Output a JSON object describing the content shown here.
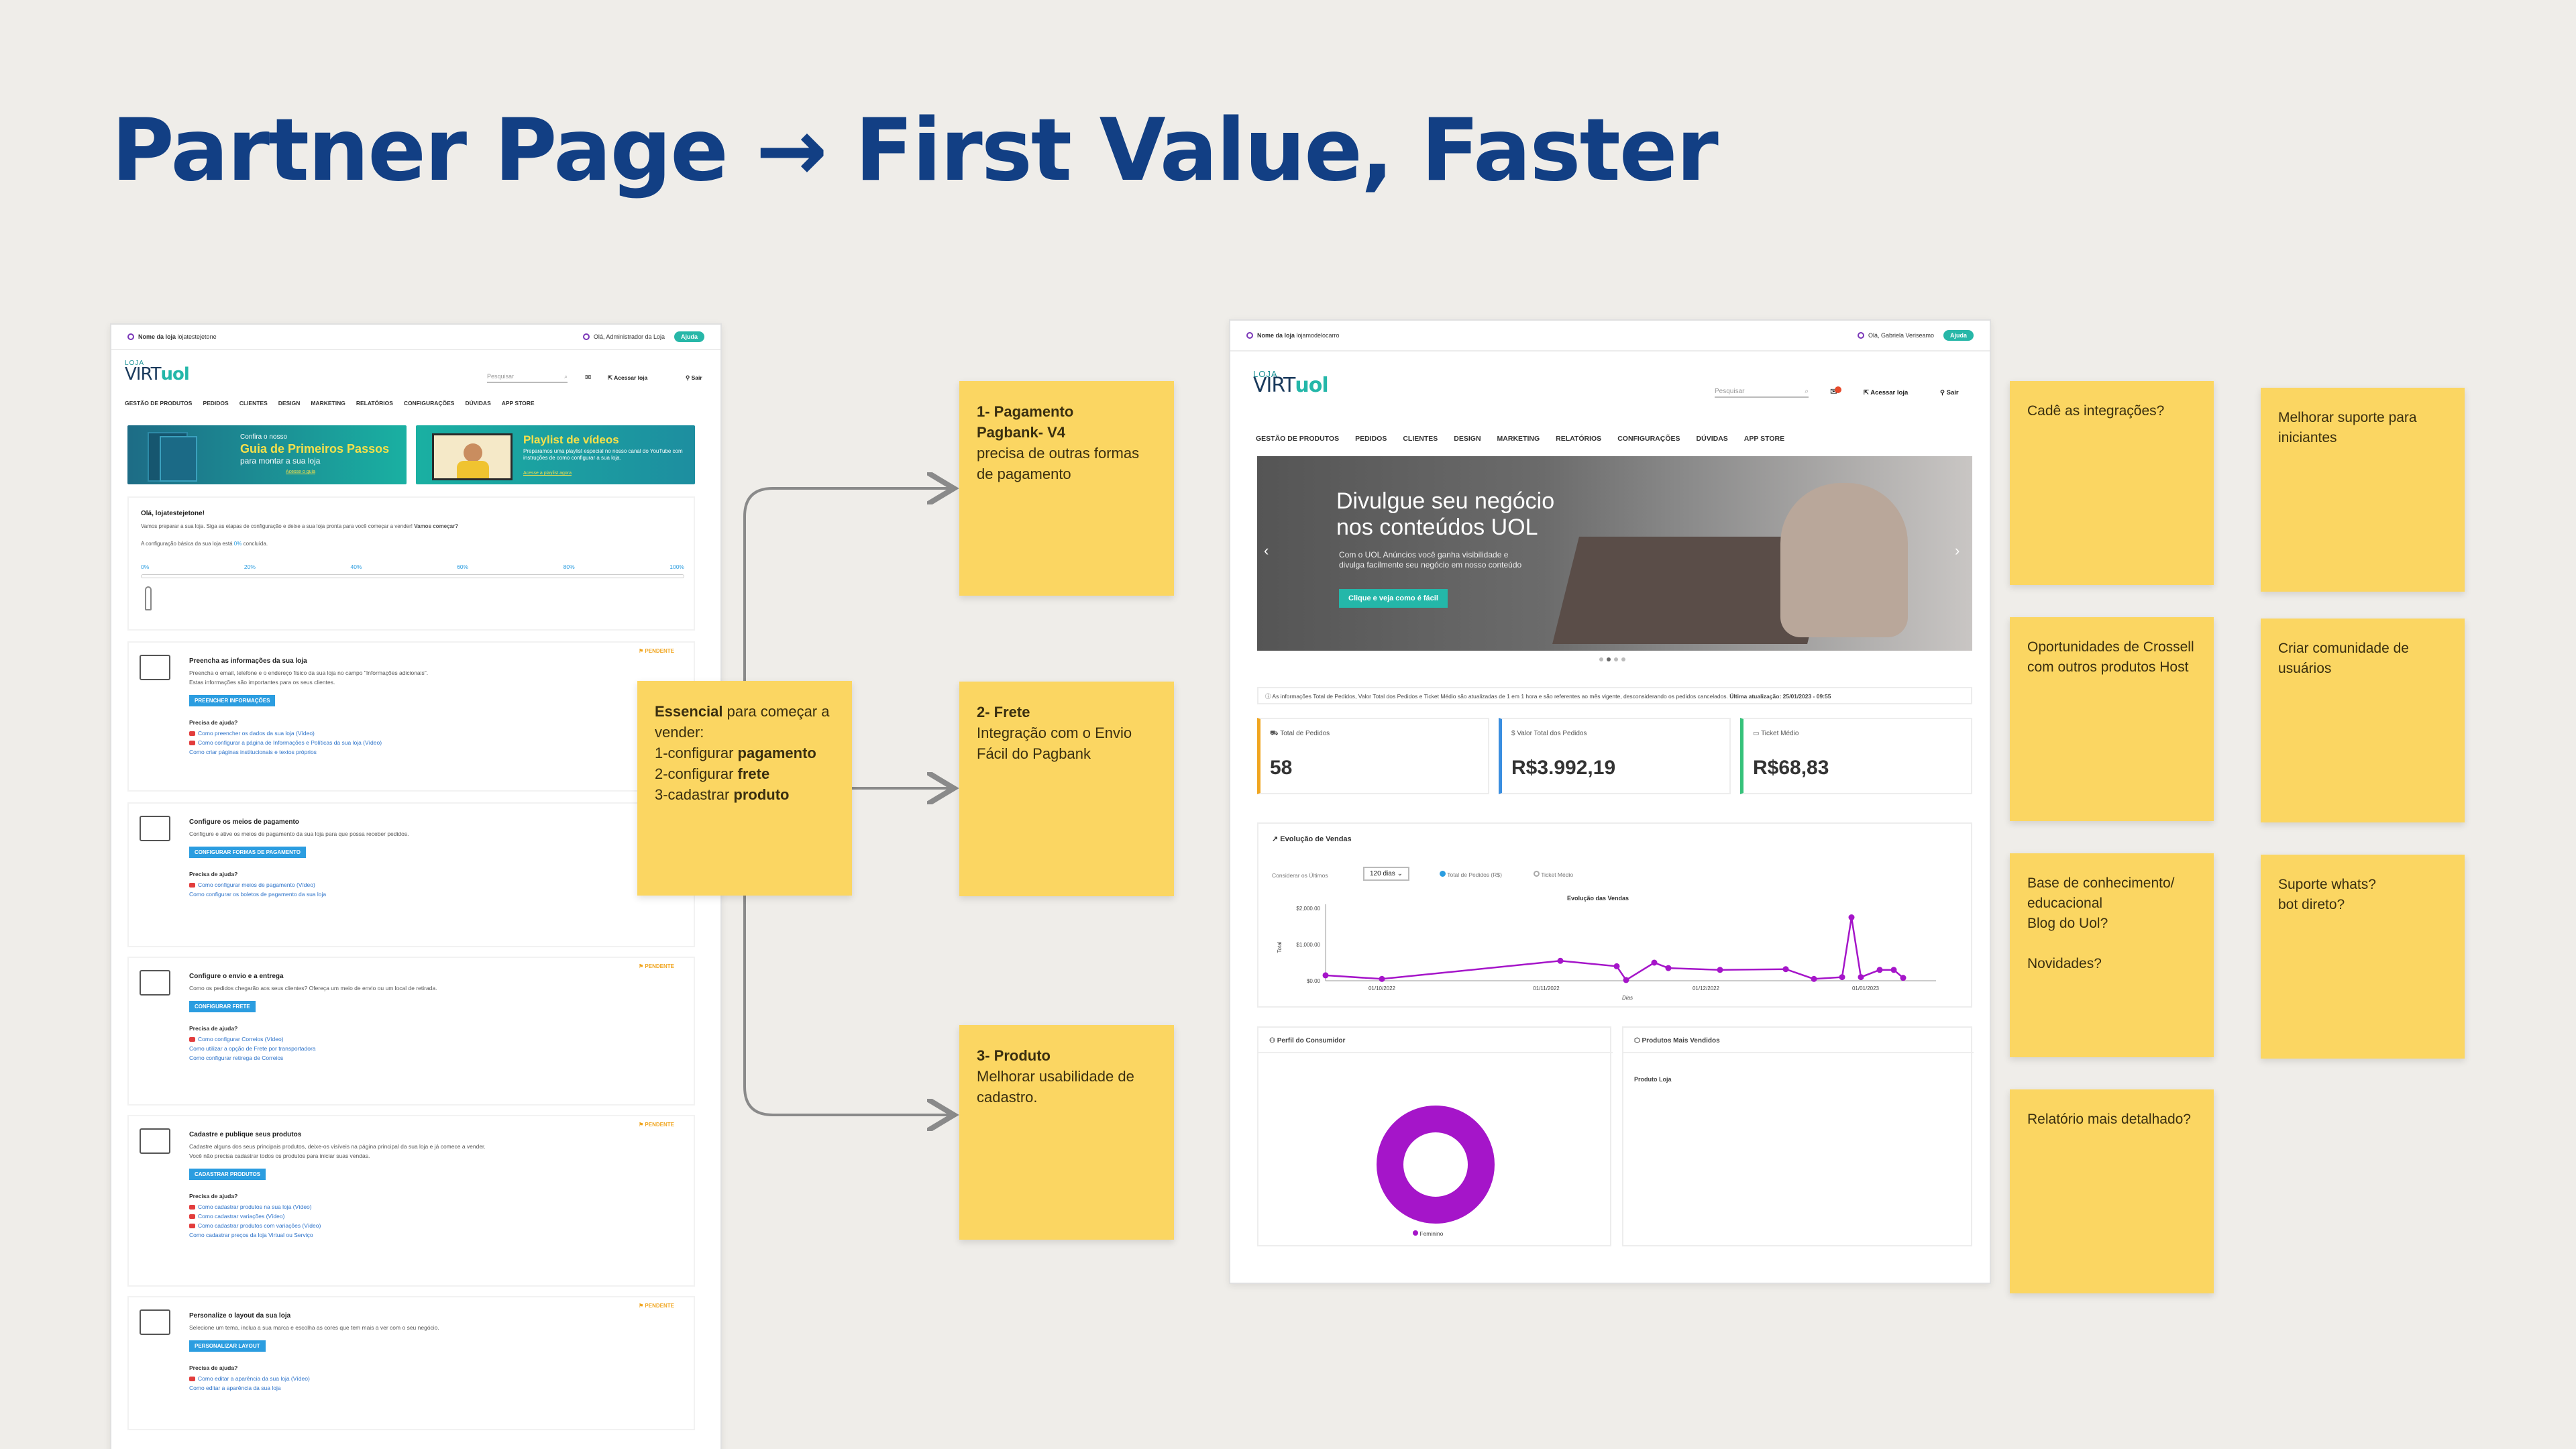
{
  "title": "Partner Page → First Value, Faster",
  "left_screen": {
    "store_label": "Nome da loja",
    "store_name": "lojatestejetone",
    "greeting": "Olá, Administrador da Loja",
    "help": "Ajuda",
    "logo_loja": "LOJA",
    "logo_virt": "VIRT",
    "logo_uol": "uol",
    "search_placeholder": "Pesquisar",
    "access_store": "Acessar loja",
    "logout": "Sair",
    "menu": [
      "GESTÃO DE PRODUTOS",
      "PEDIDOS",
      "CLIENTES",
      "DESIGN",
      "MARKETING",
      "RELATÓRIOS",
      "CONFIGURAÇÕES",
      "DÚVIDAS",
      "APP STORE"
    ],
    "banner1": {
      "pre": "Confira o nosso",
      "title": "Guia de Primeiros Passos",
      "sub": "para montar a sua loja",
      "cta": "Acesse o guia"
    },
    "banner2": {
      "title": "Playlist de vídeos",
      "text": "Preparamos uma playlist especial no nosso canal do YouTube com instruções de como configurar a sua loja.",
      "cta": "Acesse a playlist agora"
    },
    "welcome": {
      "title": "Olá, lojatestejetone!",
      "text": "Vamos preparar a sua loja. Siga as etapas de configuração e deixe a sua loja pronta para você começar a vender!",
      "cta": "Vamos começar?",
      "progress_text": "A configuração básica da sua loja está",
      "progress_value": "0%",
      "progress_suffix": "concluída.",
      "ticks": [
        "0%",
        "20%",
        "40%",
        "60%",
        "80%",
        "100%"
      ]
    },
    "pending_label": "PENDENTE",
    "help_label": "Precisa de ajuda?",
    "cards": [
      {
        "title": "Preencha as informações da sua loja",
        "desc": "Preencha o email, telefone e o endereço físico da sua loja no campo \"Informações adicionais\".",
        "desc2": "Estas informações são importantes para os seus clientes.",
        "button": "PREENCHER INFORMAÇÕES",
        "links": [
          "Como preencher os dados da sua loja (Vídeo)",
          "Como configurar a página de Informações e Políticas da sua loja (Vídeo)",
          "Como criar páginas institucionais e textos próprios"
        ]
      },
      {
        "title": "Configure os meios de pagamento",
        "desc": "Configure e ative os meios de pagamento da sua loja para que possa receber pedidos.",
        "desc2": "",
        "button": "CONFIGURAR FORMAS DE PAGAMENTO",
        "links": [
          "Como configurar meios de pagamento (Vídeo)",
          "Como configurar os boletos de pagamento da sua loja"
        ]
      },
      {
        "title": "Configure o envio e a entrega",
        "desc": "Como os pedidos chegarão aos seus clientes? Ofereça um meio de envio ou um local de retirada.",
        "desc2": "",
        "button": "CONFIGURAR FRETE",
        "links": [
          "Como configurar Correios (Vídeo)",
          "Como utilizar a opção de Frete por transportadora",
          "Como configurar retirega de Correios"
        ]
      },
      {
        "title": "Cadastre e publique seus produtos",
        "desc": "Cadastre alguns dos seus principais produtos, deixe-os visíveis na página principal da sua loja e já comece a vender.",
        "desc2": "Você não precisa cadastrar todos os produtos para iniciar suas vendas.",
        "button": "CADASTRAR PRODUTOS",
        "links": [
          "Como cadastrar produtos na sua loja (Vídeo)",
          "Como cadastrar variações (Vídeo)",
          "Como cadastrar produtos com variações (Vídeo)",
          "Como cadastrar preços da loja Virtual ou Serviço"
        ]
      },
      {
        "title": "Personalize o layout da sua loja",
        "desc": "Selecione um tema, inclua a sua marca e escolha as cores que tem mais a ver com o seu negócio.",
        "desc2": "",
        "button": "PERSONALIZAR LAYOUT",
        "links": [
          "Como editar a aparência da sua loja (Vídeo)",
          "Como editar a aparência da sua loja"
        ]
      }
    ]
  },
  "notes": {
    "center": {
      "bold": "Essencial",
      "rest": " para começar a vender:",
      "line1_pre": "1-configurar ",
      "line1_bold": "pagamento",
      "line2_pre": "2-configurar ",
      "line2_bold": "frete",
      "line3_pre": "3-cadastrar ",
      "line3_bold": "produto"
    },
    "payment": {
      "title": "1- Pagamento",
      "title2": "Pagbank- V4",
      "text": "precisa de outras formas de pagamento"
    },
    "shipping": {
      "title": "2- Frete",
      "text": "Integração com o Envio Fácil do Pagbank"
    },
    "product": {
      "title": "3- Produto",
      "text": "Melhorar usabilidade de cadastro."
    },
    "right": [
      "Cadê as integrações?",
      "Melhorar suporte para iniciantes",
      "Oportunidades de Crossell com outros produtos Host",
      "Criar comunidade de usuários",
      "Base de conhecimento/ educacional\nBlog do Uol?\n\nNovidades?",
      "Suporte whats?\nbot direto?",
      "Relatório mais detalhado?"
    ]
  },
  "right_screen": {
    "store_label": "Nome da loja",
    "store_name": "lojamodelocarro",
    "greeting": "Olá, Gabriela Veriseamo",
    "help": "Ajuda",
    "search_placeholder": "Pesquisar",
    "access_store": "Acessar loja",
    "logout": "Sair",
    "menu": [
      "GESTÃO DE PRODUTOS",
      "PEDIDOS",
      "CLIENTES",
      "DESIGN",
      "MARKETING",
      "RELATÓRIOS",
      "CONFIGURAÇÕES",
      "DÚVIDAS",
      "APP STORE"
    ],
    "hero": {
      "title1": "Divulgue seu negócio",
      "title2": "nos conteúdos UOL",
      "text1": "Com o UOL Anúncios você ganha visibilidade e",
      "text2": "divulga facilmente seu negócio em nosso conteúdo",
      "cta": "Clique e veja como é fácil"
    },
    "info_text": "As informações Total de Pedidos, Valor Total dos Pedidos e Ticket Médio são atualizadas de 1 em 1 hora e são referentes ao mês vigente, desconsiderando os pedidos cancelados.",
    "info_update_label": "Última atualização:",
    "info_update_value": "25/01/2023 - 09:55",
    "kpis": [
      {
        "label": "Total de Pedidos",
        "value": "58",
        "color": "#f0a51f"
      },
      {
        "label": "Valor Total dos Pedidos",
        "value": "R$3.992,19",
        "color": "#3a8ee0"
      },
      {
        "label": "Ticket Médio",
        "value": "R$68,83",
        "color": "#36c27a"
      }
    ],
    "sales_title": "Evolução de Vendas",
    "filter_label": "Considerar os Últimos",
    "filter_value": "120 dias",
    "radio1": "Total de Pedidos (R$)",
    "radio2": "Ticket Médio",
    "consumer_title": "Perfil do Consumidor",
    "consumer_legend": "Feminino",
    "top_products_title": "Produtos Mais Vendidos",
    "top_products_col": "Produto Loja"
  },
  "chart_data": {
    "type": "line",
    "title": "Evolução das Vendas",
    "xlabel": "Dias",
    "ylabel": "Total",
    "x_ticks": [
      "01/10/2022",
      "01/11/2022",
      "01/12/2022",
      "01/01/2023"
    ],
    "y_ticks": [
      "$0.00",
      "$1,000.00",
      "$2,000.00"
    ],
    "ylim": [
      0,
      2000
    ],
    "x": [
      0,
      12,
      50,
      62,
      64,
      70,
      73,
      84,
      98,
      104,
      110,
      112,
      114,
      118,
      121,
      123
    ],
    "values": [
      150,
      50,
      550,
      400,
      20,
      500,
      350,
      300,
      320,
      50,
      100,
      1750,
      100,
      300,
      300,
      80
    ],
    "color": "#a515c9"
  },
  "donut_data": {
    "type": "pie",
    "labels": [
      "Feminino"
    ],
    "values": [
      100
    ],
    "color": "#a515c9"
  }
}
